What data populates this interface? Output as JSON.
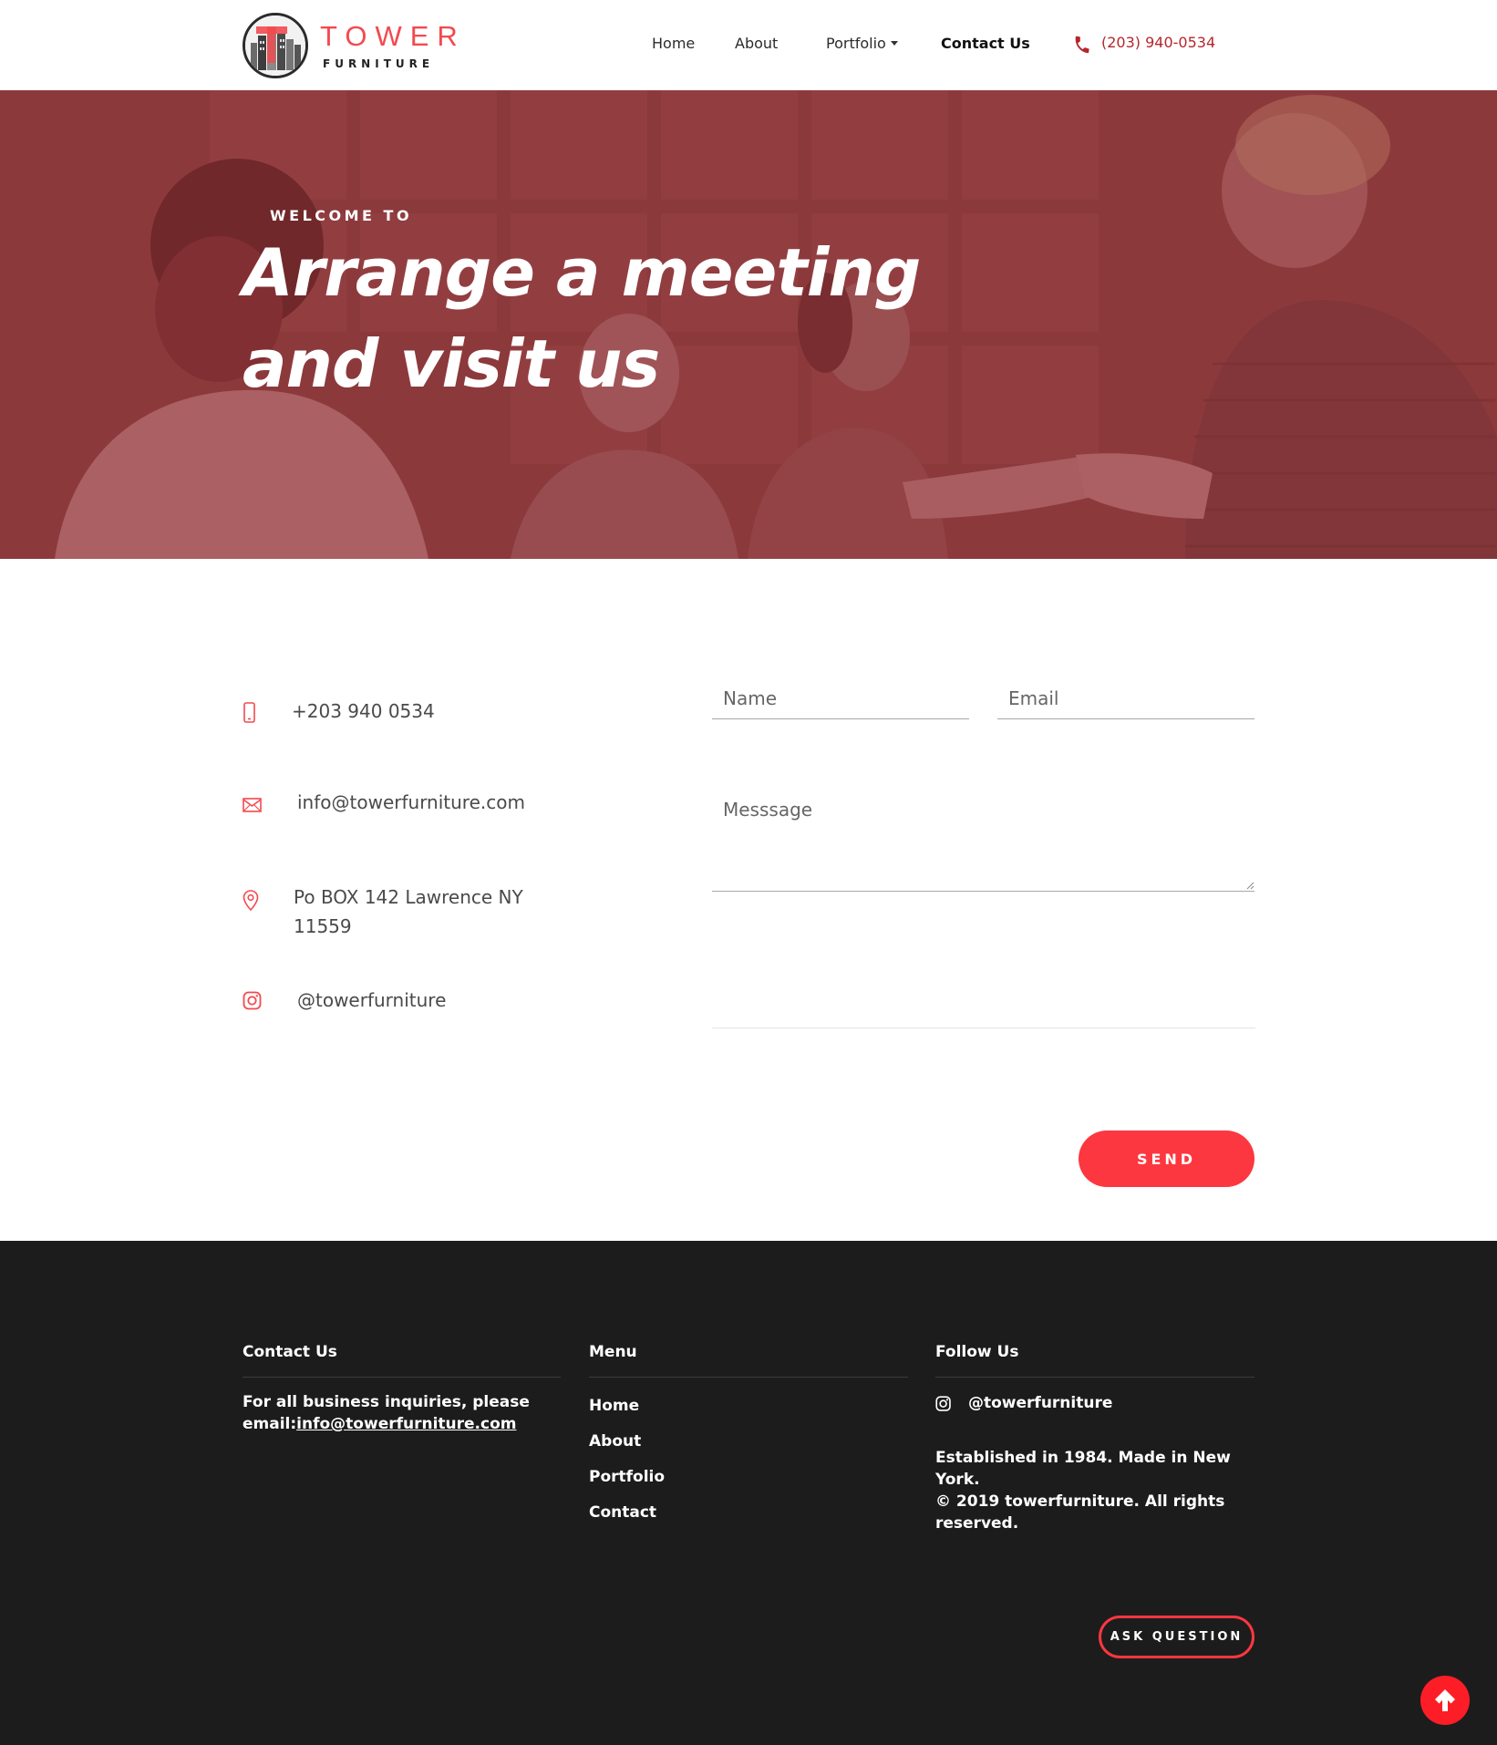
{
  "brand": {
    "name": "TOWER",
    "tagline": "FURNITURE"
  },
  "nav": {
    "items": [
      {
        "label": "Home"
      },
      {
        "label": "About"
      },
      {
        "label": "Portfolio"
      },
      {
        "label": "Contact Us"
      }
    ],
    "phone": "(203) 940-0534"
  },
  "hero": {
    "eyebrow": "WELCOME TO",
    "title_line1": "Arrange a meeting",
    "title_line2": "and visit us"
  },
  "contact_info": {
    "phone": "+203 940 0534",
    "email": "info@towerfurniture.com",
    "address_line1": "Po BOX 142 Lawrence NY",
    "address_line2": "11559",
    "instagram": "@towerfurniture"
  },
  "form": {
    "name_placeholder": "Name",
    "email_placeholder": "Email",
    "message_placeholder": "Messsage",
    "send_label": "SEND"
  },
  "footer": {
    "contact": {
      "heading": "Contact Us",
      "text_line1": "For all business inquiries, please",
      "text_prefix": "email:",
      "email": "info@towerfurniture.com"
    },
    "menu": {
      "heading": "Menu",
      "items": [
        "Home",
        "About",
        "Portfolio",
        "Contact"
      ]
    },
    "follow": {
      "heading": "Follow Us",
      "handle": "@towerfurniture",
      "about_line1": "Established in 1984. Made in New York.",
      "about_line2": "© 2019 towerfurniture. All rights",
      "about_line3": "reserved."
    },
    "ask_label": "ASK QUESTION"
  },
  "colors": {
    "accent": "#fd373f",
    "brand_red": "#f24a4f",
    "hero_overlay": "#8a3d3f",
    "footer_bg": "#1c1c1d"
  },
  "icons": {
    "phone": "phone-icon",
    "mobile": "mobile-icon",
    "mail": "mail-icon",
    "location": "location-pin-icon",
    "instagram": "instagram-icon",
    "back_to_top": "arrow-up-icon"
  }
}
